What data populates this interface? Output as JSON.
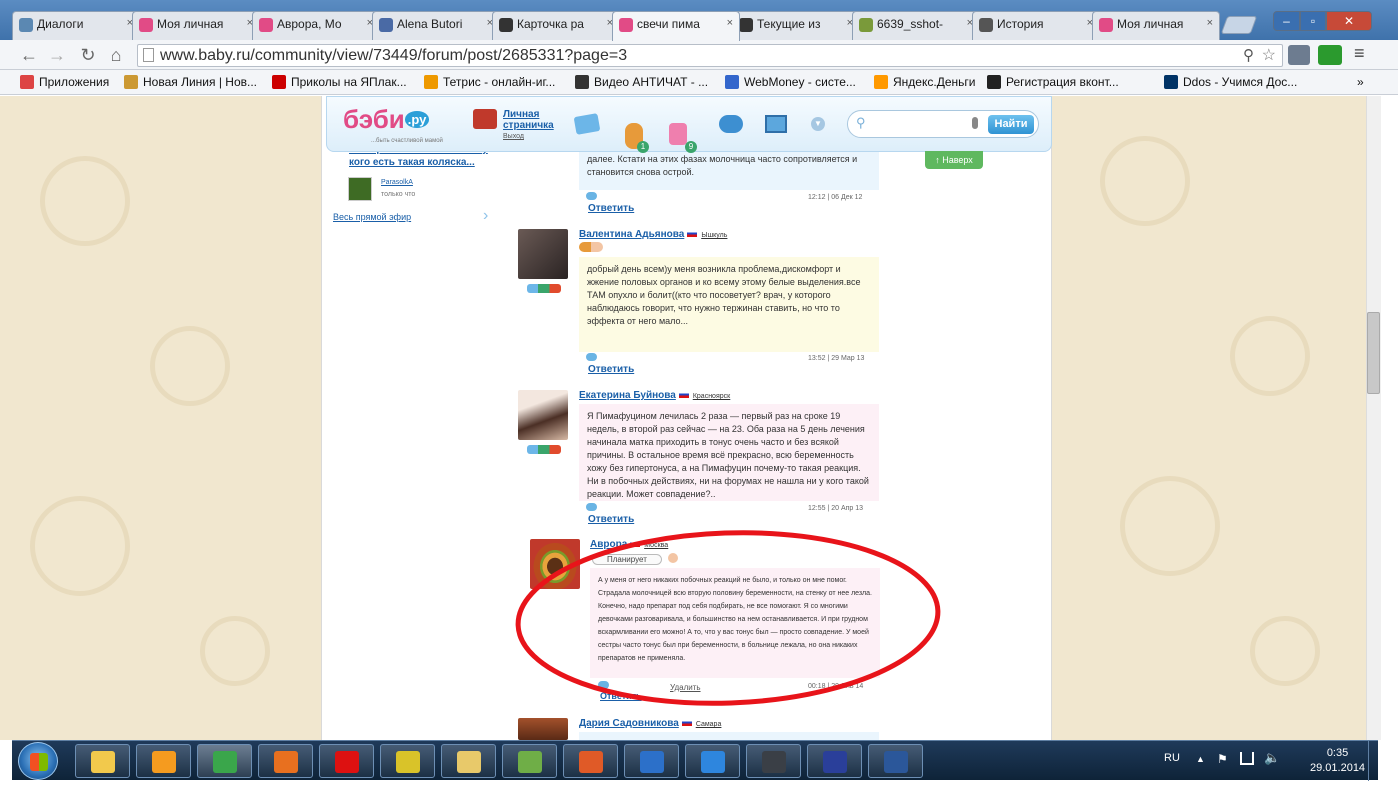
{
  "tabs": [
    {
      "title": "Диалоги",
      "icon": "vk-dialog-icon",
      "color": "#5b88b2"
    },
    {
      "title": "Моя личная",
      "icon": "babyru-icon",
      "color": "#e14b86"
    },
    {
      "title": "Аврора, Мо",
      "icon": "babyru-icon",
      "color": "#e14b86"
    },
    {
      "title": "Alena Butori",
      "icon": "b-site-icon",
      "color": "#4a6aa5"
    },
    {
      "title": "Карточка ра",
      "icon": "a-site-icon",
      "color": "#333333"
    },
    {
      "title": "свечи пима",
      "icon": "babyru-icon",
      "color": "#e14b86"
    },
    {
      "title": "Текущие из",
      "icon": "a-site-icon",
      "color": "#333333"
    },
    {
      "title": "6639_sshot-",
      "icon": "image-icon",
      "color": "#7a9a3a"
    },
    {
      "title": "История",
      "icon": "history-icon",
      "color": "#555555"
    },
    {
      "title": "Моя личная",
      "icon": "babyru-icon",
      "color": "#e14b86"
    }
  ],
  "active_tab": 5,
  "url": "www.baby.ru/community/view/73449/forum/post/2685331?page=3",
  "bookmarks": [
    {
      "label": "Приложения",
      "icon": "apps-icon",
      "color": "#d44"
    },
    {
      "label": "Новая Линия | Нов...",
      "icon": "globe-icon",
      "color": "#c93"
    },
    {
      "label": "Приколы на ЯПлак...",
      "icon": "yap-icon",
      "color": "#c00"
    },
    {
      "label": "Тетрис - онлайн-иг...",
      "icon": "tetris-icon",
      "color": "#e90"
    },
    {
      "label": "Видео АНТИЧАТ - ...",
      "icon": "antichat-icon",
      "color": "#333"
    },
    {
      "label": "WebMoney - систе...",
      "icon": "webmoney-icon",
      "color": "#36c"
    },
    {
      "label": "Яндекс.Деньги",
      "icon": "yandex-money-icon",
      "color": "#f90"
    },
    {
      "label": "Регистрация вконт...",
      "icon": "a-site-icon",
      "color": "#222"
    },
    {
      "label": "Ddos - Учимся Дос...",
      "icon": "bit-icon",
      "color": "#036"
    }
  ],
  "bookmarks_overflow": "»",
  "site": {
    "logo": "бэби",
    "logo_tld": ".ру",
    "slogan": "...быть счастливой мамой",
    "profile_link": "Личная страничка",
    "logout": "Выход",
    "badge_friends": "1",
    "badge_messages": "9",
    "search_button": "Найти",
    "up_button": "Наверх"
  },
  "sidebar": {
    "teaser_title": "Уdumpleto отомкнитесь те у кого есть такая коляска...",
    "author": "ParasolkA",
    "author_time": "только что",
    "live_link": "Весь прямой эфир"
  },
  "posts": [
    {
      "name": "",
      "city": "",
      "text": "далее. Кстати на этих фазах молочница часто сопротивляется и становится снова острой.",
      "reply": "Ответить",
      "time": "12:12 | 06 Дек 12",
      "bg": "#eaf5fd"
    },
    {
      "name": "Валентина Адьянова",
      "city": "Ышкуль",
      "text": "добрый день всем)у меня возникла проблема,дискомфорт и жжение половых органов и ко всему этому белые выделения.все ТАМ опухло и болит((кто что посоветует? врач, у которого наблюдаюсь говорит, что нужно тержинан ставить, но что то эффекта от него мало...",
      "reply": "Ответить",
      "time": "13:52 | 29 Мар 13",
      "bg": "#fdfbe3"
    },
    {
      "name": "Екатерина Буйнова",
      "city": "Красноярск",
      "text": "Я Пимафуцином лечилась 2 раза — первый раз на сроке 19 недель, в второй раз сейчас — на 23. Оба раза на 5 день лечения начинала матка приходить в тонус очень часто и без всякой причины. В остальное время всё прекрасно, всю беременность хожу без гипертонуса, а на Пимафуцин почему-то такая реакция. Ни в побочных действиях, ни на форумах не нашла ни у кого такой реакции. Может совпадение?..",
      "reply": "Ответить",
      "time": "12:55 | 20 Апр 13",
      "bg": "#fdf0f6"
    },
    {
      "name": "Аврора",
      "city": "Москва",
      "status": "Планирует",
      "text": "А у меня от него никаких побочных реакций не было, и только он мне помог. Страдала молочницей всю вторую половину беременности, на стенку от нее лезла. Конечно, надо препарат под себя подбирать, не все помогают. Я со многими девочками разговаривала, и большинство на нем останавливается. И при грудном вскармливании его можно! А то, что у вас тонус был — просто совпадение. У моей сестры часто тонус был при беременности, в больнице лежала, но она никаких препаратов не применяла.",
      "reply": "Ответить",
      "delete": "Удалить",
      "time": "00:18 | 29 Янв 14",
      "bg": "#fdf0f6"
    },
    {
      "name": "Дария Садовникова",
      "city": "Самара",
      "text": "",
      "reply": "",
      "time": "",
      "bg": "#eaf5fd"
    }
  ],
  "taskbar": {
    "apps": [
      {
        "name": "explorer-icon",
        "color": "#f2c94c"
      },
      {
        "name": "media-player-icon",
        "color": "#f59b1f"
      },
      {
        "name": "chrome-icon",
        "color": "#3aa64b"
      },
      {
        "name": "firefox-icon",
        "color": "#e8701f"
      },
      {
        "name": "opera-icon",
        "color": "#d11"
      },
      {
        "name": "network-tool-icon",
        "color": "#d9c329"
      },
      {
        "name": "snipping-icon",
        "color": "#e8c96a"
      },
      {
        "name": "notepad-icon",
        "color": "#6fae47"
      },
      {
        "name": "power-icon",
        "color": "#e05a27"
      },
      {
        "name": "timer-icon",
        "color": "#2c70c9"
      },
      {
        "name": "sync-icon",
        "color": "#2e86de"
      },
      {
        "name": "steam-icon",
        "color": "#3a3f46"
      },
      {
        "name": "floppy-icon",
        "color": "#2a3f9a"
      },
      {
        "name": "word-icon",
        "color": "#2b579a"
      }
    ],
    "language": "RU",
    "time": "0:35",
    "date": "29.01.2014"
  },
  "annotation_color": "#e8141a"
}
